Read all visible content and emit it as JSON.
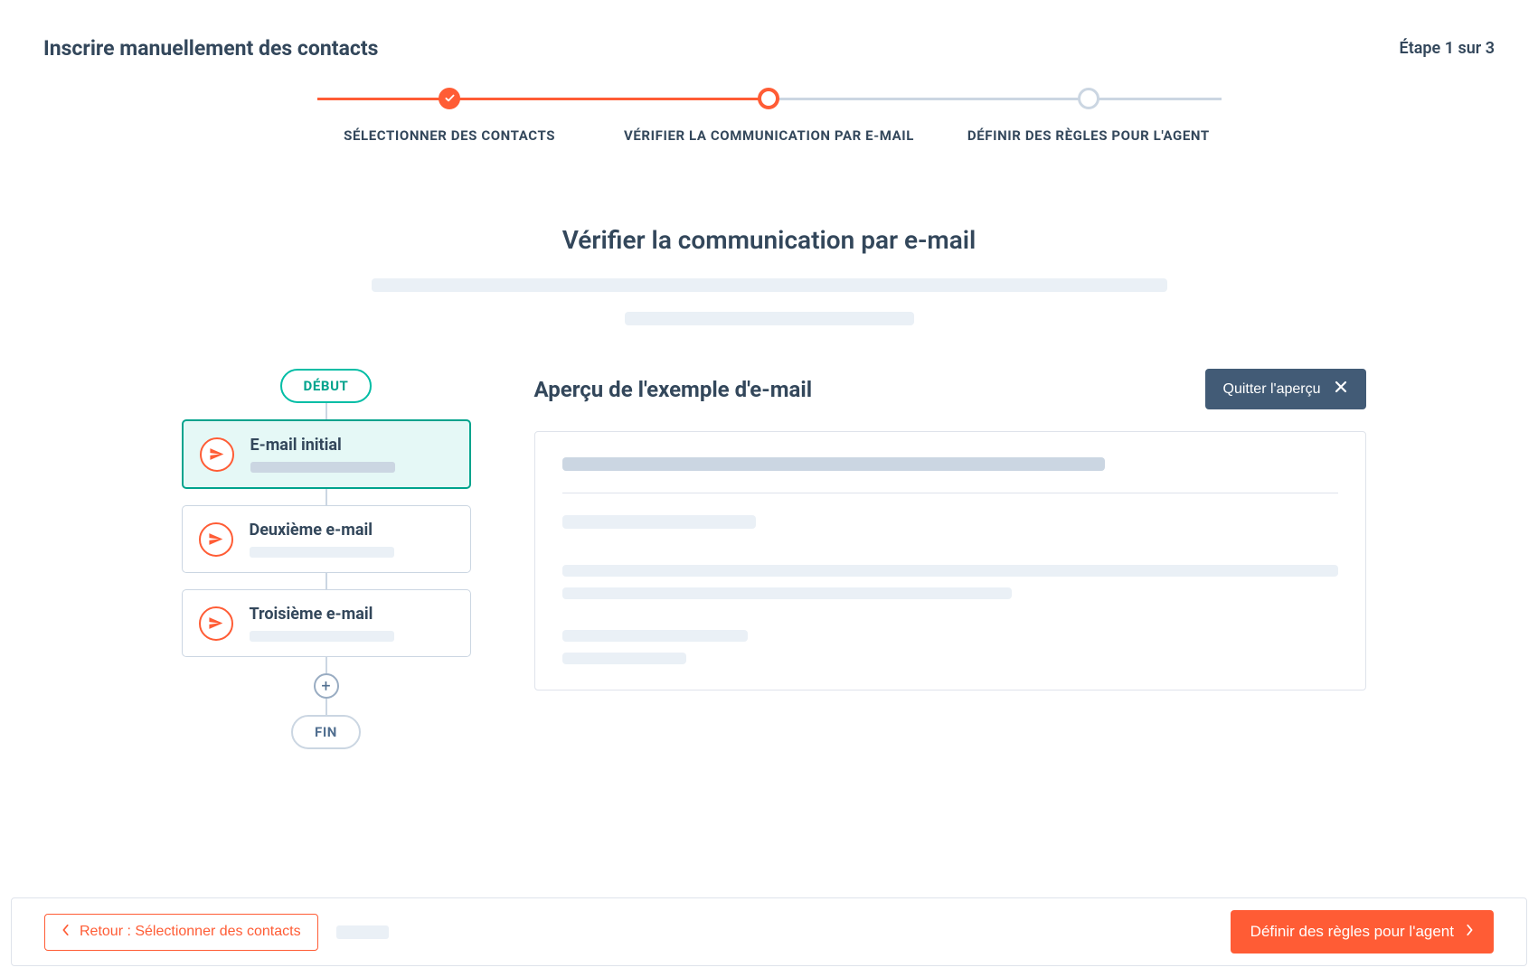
{
  "header": {
    "title": "Inscrire manuellement des contacts",
    "step_indicator": "Étape 1 sur 3"
  },
  "stepper": {
    "steps": [
      {
        "label": "SÉLECTIONNER DES CONTACTS",
        "state": "done"
      },
      {
        "label": "VÉRIFIER LA COMMUNICATION PAR E-MAIL",
        "state": "active"
      },
      {
        "label": "DÉFINIR DES RÈGLES POUR L'AGENT",
        "state": "todo"
      }
    ]
  },
  "main": {
    "title": "Vérifier la communication par e-mail"
  },
  "flow": {
    "start_label": "DÉBUT",
    "end_label": "FIN",
    "cards": [
      {
        "title": "E-mail initial",
        "icon": "send-icon",
        "active": true
      },
      {
        "title": "Deuxième e-mail",
        "icon": "send-icon",
        "active": false
      },
      {
        "title": "Troisième e-mail",
        "icon": "send-icon",
        "active": false
      }
    ]
  },
  "preview": {
    "title": "Aperçu de l'exemple d'e-mail",
    "quit_label": "Quitter l'aperçu"
  },
  "footer": {
    "back_label": "Retour : Sélectionner des contacts",
    "next_label": "Définir des règles pour l'agent"
  },
  "colors": {
    "accent": "#ff5c35",
    "teal": "#00a38d",
    "slate": "#425b76",
    "text": "#33475b"
  }
}
